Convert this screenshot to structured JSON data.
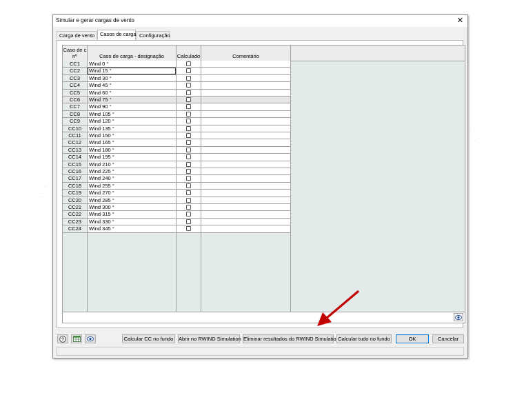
{
  "window": {
    "title": "Simular e gerar cargas de vento",
    "close_glyph": "✕"
  },
  "tabs": [
    {
      "label": "Carga de vento",
      "active": false
    },
    {
      "label": "Casos de carga",
      "active": true
    },
    {
      "label": "Configuração",
      "active": false
    }
  ],
  "table": {
    "headers": {
      "no": "Caso de c\nnº",
      "name": "Caso de carga - designação",
      "calc": "Calculado",
      "comment": "Comentário"
    },
    "rows": [
      {
        "no": "CC1",
        "name": "Wind 0 °"
      },
      {
        "no": "CC2",
        "name": "Wind 15 °"
      },
      {
        "no": "CC3",
        "name": "Wind 30 °"
      },
      {
        "no": "CC4",
        "name": "Wind 45 °"
      },
      {
        "no": "CC5",
        "name": "Wind 60 °"
      },
      {
        "no": "CC6",
        "name": "Wind 75 °"
      },
      {
        "no": "CC7",
        "name": "Wind 90 °"
      },
      {
        "no": "CC8",
        "name": "Wind 105 °"
      },
      {
        "no": "CC9",
        "name": "Wind 120 °"
      },
      {
        "no": "CC10",
        "name": "Wind 135 °"
      },
      {
        "no": "CC11",
        "name": "Wind 150 °"
      },
      {
        "no": "CC12",
        "name": "Wind 165 °"
      },
      {
        "no": "CC13",
        "name": "Wind 180 °"
      },
      {
        "no": "CC14",
        "name": "Wind 195 °"
      },
      {
        "no": "CC15",
        "name": "Wind 210 °"
      },
      {
        "no": "CC16",
        "name": "Wind 225 °"
      },
      {
        "no": "CC17",
        "name": "Wind 240 °"
      },
      {
        "no": "CC18",
        "name": "Wind 255 °"
      },
      {
        "no": "CC19",
        "name": "Wind 270 °"
      },
      {
        "no": "CC20",
        "name": "Wind 285 °"
      },
      {
        "no": "CC21",
        "name": "Wind 300 °"
      },
      {
        "no": "CC22",
        "name": "Wind 315 °"
      },
      {
        "no": "CC23",
        "name": "Wind 330 °"
      },
      {
        "no": "CC24",
        "name": "Wind 345 °"
      }
    ],
    "editing_row": "CC2",
    "selected_row": "CC6"
  },
  "buttons": {
    "calc_bg": "Calcular CC no fundo",
    "open_rwind": "Abrir no RWIND Simulation",
    "delete_results": "Eliminar resultados do RWIND Simulation",
    "calc_all_bg": "Calcular tudo no fundo",
    "ok": "OK",
    "cancel": "Cancelar"
  },
  "icons": {
    "help": "help-icon",
    "table": "table-icon",
    "view": "eye-icon"
  },
  "colors": {
    "arrow": "#c00000",
    "accent": "#0078d7",
    "grid_bg": "#e3eaea"
  }
}
